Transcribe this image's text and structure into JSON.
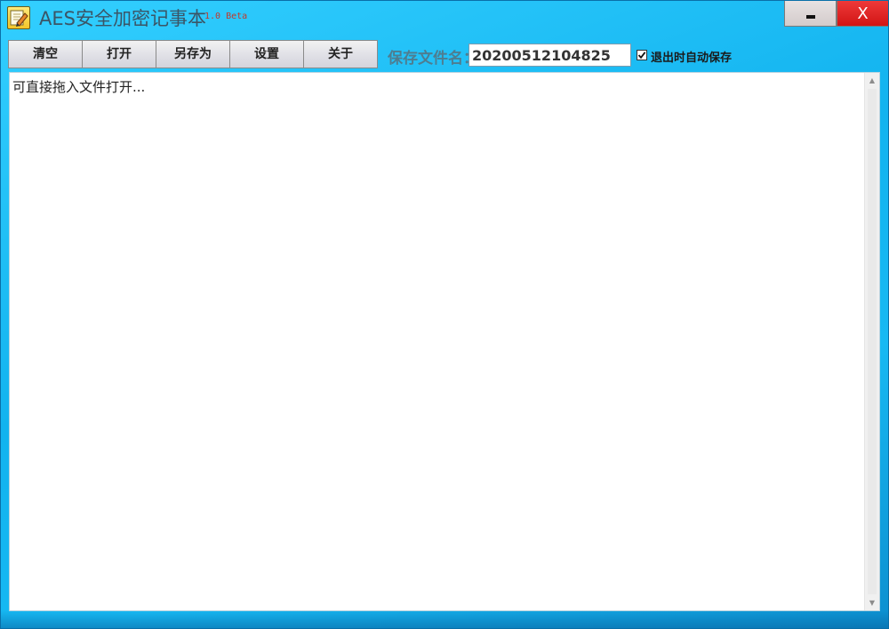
{
  "window": {
    "title": "AES安全加密记事本",
    "version": "1.0 Beta",
    "icon": "notepad-pencil-icon",
    "close_label": "X",
    "accent_color": "#17b9f3",
    "close_color": "#d11414"
  },
  "toolbar": {
    "buttons": [
      {
        "name": "clear",
        "label": "清空"
      },
      {
        "name": "open",
        "label": "打开"
      },
      {
        "name": "save-as",
        "label": "另存为"
      },
      {
        "name": "settings",
        "label": "设置"
      },
      {
        "name": "about",
        "label": "关于"
      }
    ],
    "filename_label": "保存文件名：",
    "filename_value": "20200512104825",
    "autosave_label": "退出时自动保存",
    "autosave_checked": true
  },
  "editor": {
    "content": "可直接拖入文件打开..."
  }
}
